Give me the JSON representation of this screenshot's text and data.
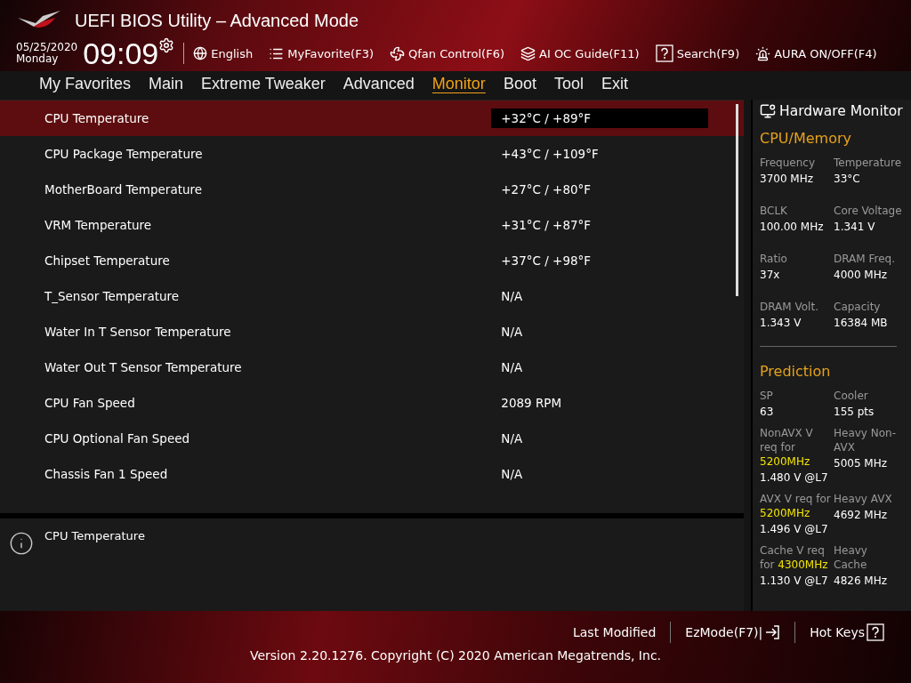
{
  "header": {
    "title": "UEFI BIOS Utility – Advanced Mode",
    "date": "05/25/2020",
    "day": "Monday",
    "time": "09:09",
    "toolbar": [
      {
        "kind": "language",
        "label": "English"
      },
      {
        "kind": "favorite",
        "label": "MyFavorite(F3)"
      },
      {
        "kind": "fan",
        "label": "Qfan Control(F6)"
      },
      {
        "kind": "guide",
        "label": "AI OC Guide(F11)"
      },
      {
        "kind": "search",
        "label": "Search(F9)"
      },
      {
        "kind": "aura",
        "label": "AURA ON/OFF(F4)"
      }
    ]
  },
  "tabs": [
    {
      "label": "My Favorites",
      "selected": false
    },
    {
      "label": "Main",
      "selected": false
    },
    {
      "label": "Extreme Tweaker",
      "selected": false
    },
    {
      "label": "Advanced",
      "selected": false
    },
    {
      "label": "Monitor",
      "selected": true
    },
    {
      "label": "Boot",
      "selected": false
    },
    {
      "label": "Tool",
      "selected": false
    },
    {
      "label": "Exit",
      "selected": false
    }
  ],
  "rows": [
    {
      "label": "CPU Temperature",
      "value": "+32°C / +89°F",
      "selected": true
    },
    {
      "label": "CPU Package Temperature",
      "value": "+43°C / +109°F",
      "selected": false
    },
    {
      "label": "MotherBoard Temperature",
      "value": "+27°C / +80°F",
      "selected": false
    },
    {
      "label": "VRM Temperature",
      "value": "+31°C / +87°F",
      "selected": false
    },
    {
      "label": "Chipset Temperature",
      "value": "+37°C / +98°F",
      "selected": false
    },
    {
      "label": "T_Sensor Temperature",
      "value": "N/A",
      "selected": false
    },
    {
      "label": "Water In T Sensor Temperature",
      "value": "N/A",
      "selected": false
    },
    {
      "label": "Water Out T Sensor Temperature",
      "value": "N/A",
      "selected": false
    },
    {
      "label": "CPU Fan Speed",
      "value": "2089 RPM",
      "selected": false
    },
    {
      "label": "CPU Optional Fan Speed",
      "value": "N/A",
      "selected": false
    },
    {
      "label": "Chassis Fan 1 Speed",
      "value": "N/A",
      "selected": false
    }
  ],
  "help": {
    "text": "CPU Temperature"
  },
  "hardware_monitor": {
    "title": "Hardware Monitor",
    "sections": [
      {
        "title": "CPU/Memory",
        "items": [
          {
            "label": "Frequency",
            "value": "3700 MHz"
          },
          {
            "label": "Temperature",
            "value": "33°C"
          },
          {
            "label": "BCLK",
            "value": "100.00 MHz"
          },
          {
            "label": "Core Voltage",
            "value": "1.341 V"
          },
          {
            "label": "Ratio",
            "value": "37x"
          },
          {
            "label": "DRAM Freq.",
            "value": "4000 MHz"
          },
          {
            "label": "DRAM Volt.",
            "value": "1.343 V"
          },
          {
            "label": "Capacity",
            "value": "16384 MB"
          }
        ]
      },
      {
        "title": "Prediction",
        "items": [
          {
            "label": "SP",
            "value": "63"
          },
          {
            "label": "Cooler",
            "value": "155 pts"
          },
          {
            "label": "NonAVX V req for **5200MHz**",
            "value": "1.480 V @L7"
          },
          {
            "label": "Heavy Non-AVX",
            "value": "5005 MHz"
          },
          {
            "label": "AVX V req for **5200MHz**",
            "value": "1.496 V @L7"
          },
          {
            "label": "Heavy AVX",
            "value": "4692 MHz"
          },
          {
            "label": "Cache V req for **4300MHz**",
            "value": "1.130 V @L7"
          },
          {
            "label": "Heavy Cache",
            "value": "4826 MHz"
          }
        ]
      }
    ]
  },
  "footer": {
    "last_modified": "Last Modified",
    "ez_mode": "EzMode(F7)|",
    "hot_keys": "Hot Keys",
    "version": "Version 2.20.1276. Copyright (C) 2020 American Megatrends, Inc."
  }
}
